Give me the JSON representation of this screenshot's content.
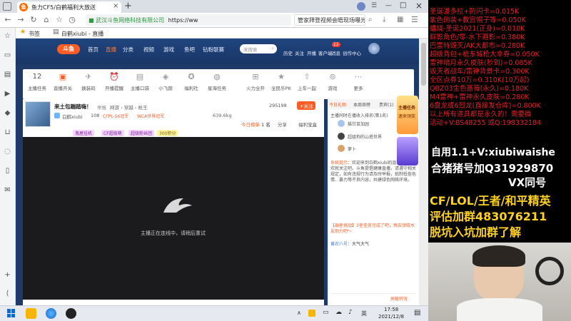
{
  "browser": {
    "tab_title": "鱼力CF5/白鹤福利大放送",
    "tab_close": "×",
    "new_tab": "+",
    "window_minimize": "—",
    "window_maximize": "□",
    "window_close": "×",
    "url_org": "武汉斗鱼网络科技有限公司",
    "url": "https://ww",
    "search_text": "管家拜登视频会晤现场曝光",
    "bookmarks_label": "书签",
    "bookmark_item": "白鹤xiubi - 直播"
  },
  "site": {
    "logo": "斗鱼",
    "nav": [
      "首页",
      "直播",
      "分类",
      "视频",
      "游戏",
      "鱼吧",
      "钻粉联赛"
    ],
    "search_placeholder": "来搜索",
    "right_items": [
      "历史",
      "关注",
      "开播",
      "客户端",
      "消息",
      "创作中心"
    ],
    "msg_badge": "22"
  },
  "categories": [
    {
      "icon": "12",
      "label": "主播任务"
    },
    {
      "icon": "▣",
      "label": "直播开关"
    },
    {
      "icon": "✈",
      "label": "换装码"
    },
    {
      "icon": "⏰",
      "label": "开播提醒"
    },
    {
      "icon": "▤",
      "label": "主播口袋"
    },
    {
      "icon": "◈",
      "label": "小飞蹄"
    },
    {
      "icon": "✪",
      "label": "福利社"
    },
    {
      "icon": "◍",
      "label": "星海任务"
    },
    {
      "icon": "⊞",
      "label": "火力全开"
    },
    {
      "icon": "★",
      "label": "全民乐PK"
    },
    {
      "icon": "⇧",
      "label": "上车一起"
    },
    {
      "icon": "⊚",
      "label": "游戏"
    },
    {
      "icon": "⋯",
      "label": "更多"
    }
  ],
  "room": {
    "title": "来土包踹踏嗨！",
    "report": "举报",
    "nav_path": "网游 › 穿越 › 枪王",
    "streamer": "白鹤xiubi",
    "level": "108",
    "badges": [
      "CFPL-S6冠军",
      "WCA世界冠军"
    ],
    "hot": "295198",
    "follow": "+关注",
    "followers": "639.6kg",
    "today_rank": "今日榜单",
    "rank_value": "1 名",
    "share": "分享",
    "fan_club": "福利宝盒",
    "tags": [
      "鬼屋挂机",
      "CF超级萌",
      "超级粉丝团",
      "300积分"
    ],
    "loading_text": "主播正在连线中，请稍后重试"
  },
  "chat": {
    "tabs": [
      "今日礼物",
      "本周周榜",
      "贵宾(1)"
    ],
    "notice": "主播同时在播收入排名(第1名)",
    "ranks": [
      {
        "name": "猫甘苗加园"
      },
      {
        "name": "超级狗的山塔世界"
      },
      {
        "name": "萝卜"
      }
    ],
    "system_label": "系统提示：",
    "system_msg": "欢迎来到白鹤xiubi的直播间。喜欢就关注吧。斗鱼提倡健康直播，请遵守相关规定，如有违规行为请及时举报，抵制低俗色情、暴力等不良内容，共建绿色网络环境。",
    "activity_msg": "【福星挑战】3星任务完成了吧，快去领取水友助力吧～",
    "user_name": "黄农八号：",
    "user_msg": "大气大气",
    "input_placeholder": "屏蔽特效",
    "promo_title": "主播任务",
    "promo_sub": "速来领奖"
  },
  "overlay": {
    "lines": [
      "圣诞潘多拉+防闪卡=0.015K",
      "紫色侧装+教官帽子等=0.050K",
      "蟠烧-圣诞2021(正身)=0.010K",
      "鲜影角色/零-水下避影=0.380K",
      "巴雷特毁灭/AK大都市=0.280K",
      "超级背包+枪东城枪大幸券=0.050K",
      "雷神暗月永久皮肤(秒到)=0.085K",
      "毁灭者战车/雷神背景卡=0.300K",
      "全区点券10万=0.310K(10万起)",
      "QBZ03金色蔷薇(永久)=0.180K",
      "M4雷神+雷神永久皮肤=0.280K",
      "6盘龙或6烈龙(直接发仓库)=0.800K",
      "以上所有道具都是永久的！需要微",
      "活动+V:BS48255  或Q:198332184"
    ],
    "self_use": "自用1.1+V:xiubiwaishe",
    "pig_group": "合猪猪号加Q31929870",
    "vx": "VX同号",
    "cf_line": "CF/LOL/王者/和平精英",
    "eval_group": "评估加群483076211",
    "pit_group": "脱坑入坑加群了解"
  },
  "taskbar": {
    "time": "17:58",
    "date": "2021/12/8",
    "lang": "英",
    "show_hidden": "∧"
  },
  "colors": {
    "overlay_red": "#e0222a",
    "site_blue": "#1d3a69",
    "douyu_orange": "#ff5d23"
  }
}
